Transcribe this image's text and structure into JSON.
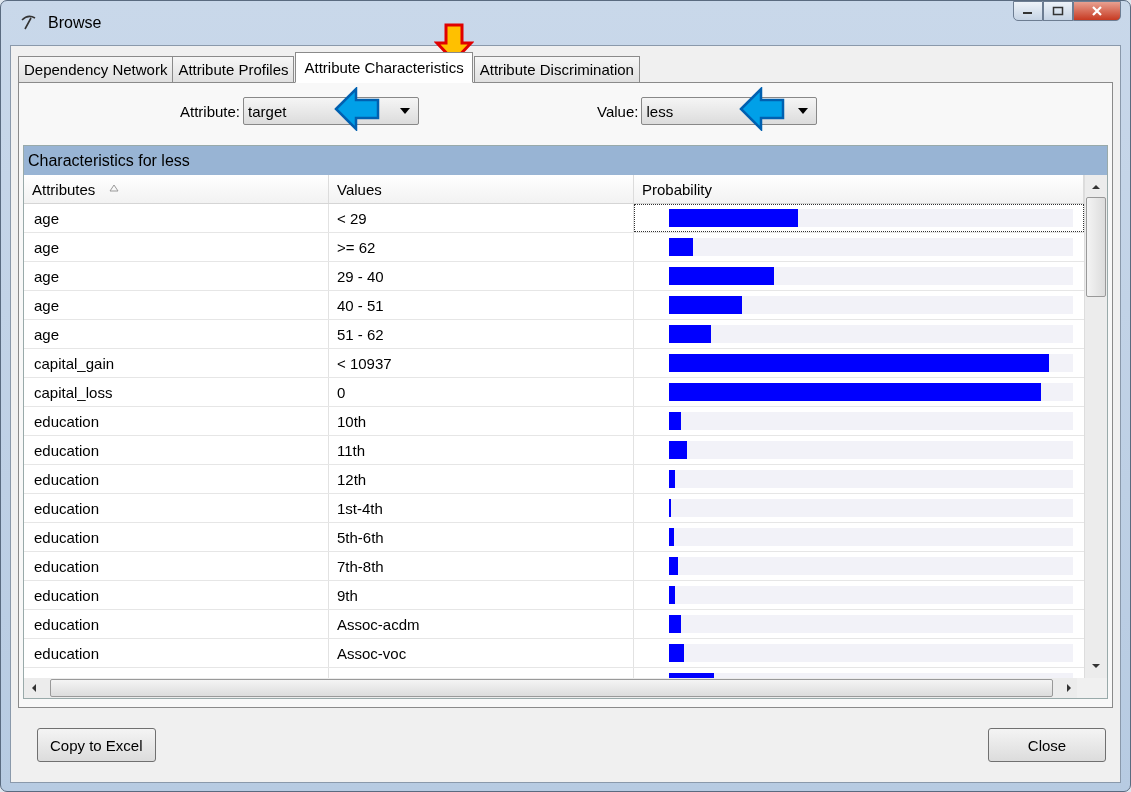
{
  "window": {
    "title": "Browse"
  },
  "tabs": [
    {
      "label": "Dependency Network",
      "selected": false
    },
    {
      "label": "Attribute Profiles",
      "selected": false
    },
    {
      "label": "Attribute Characteristics",
      "selected": true
    },
    {
      "label": "Attribute Discrimination",
      "selected": false
    }
  ],
  "filters": [
    {
      "label": "Attribute:",
      "value": "target"
    },
    {
      "label": "Value:",
      "value": "less"
    }
  ],
  "panel": {
    "title": "Characteristics for less"
  },
  "table": {
    "columns": [
      {
        "label": "Attributes",
        "sorted": true
      },
      {
        "label": "Values",
        "sorted": false
      },
      {
        "label": "Probability",
        "sorted": false
      }
    ],
    "rows": [
      {
        "attribute": "age",
        "value": "< 29",
        "level": 0.32,
        "focused": true
      },
      {
        "attribute": "age",
        "value": ">= 62",
        "level": 0.06,
        "focused": false
      },
      {
        "attribute": "age",
        "value": "29 - 40",
        "level": 0.26,
        "focused": false
      },
      {
        "attribute": "age",
        "value": "40 - 51",
        "level": 0.18,
        "focused": false
      },
      {
        "attribute": "age",
        "value": "51 - 62",
        "level": 0.105,
        "focused": false
      },
      {
        "attribute": "capital_gain",
        "value": "< 10937",
        "level": 0.94,
        "focused": false
      },
      {
        "attribute": "capital_loss",
        "value": "0",
        "level": 0.92,
        "focused": false
      },
      {
        "attribute": "education",
        "value": "10th",
        "level": 0.03,
        "focused": false
      },
      {
        "attribute": "education",
        "value": "11th",
        "level": 0.044,
        "focused": false
      },
      {
        "attribute": "education",
        "value": "12th",
        "level": 0.015,
        "focused": false
      },
      {
        "attribute": "education",
        "value": "1st-4th",
        "level": 0.005,
        "focused": false
      },
      {
        "attribute": "education",
        "value": "5th-6th",
        "level": 0.012,
        "focused": false
      },
      {
        "attribute": "education",
        "value": "7th-8th",
        "level": 0.022,
        "focused": false
      },
      {
        "attribute": "education",
        "value": "9th",
        "level": 0.015,
        "focused": false
      },
      {
        "attribute": "education",
        "value": "Assoc-acdm",
        "level": 0.03,
        "focused": false
      },
      {
        "attribute": "education",
        "value": "Assoc-voc",
        "level": 0.036,
        "focused": false
      },
      {
        "level": 0.112,
        "focused": false
      }
    ]
  },
  "buttons": [
    {
      "label": "Copy to Excel"
    },
    {
      "label": "Close"
    }
  ]
}
